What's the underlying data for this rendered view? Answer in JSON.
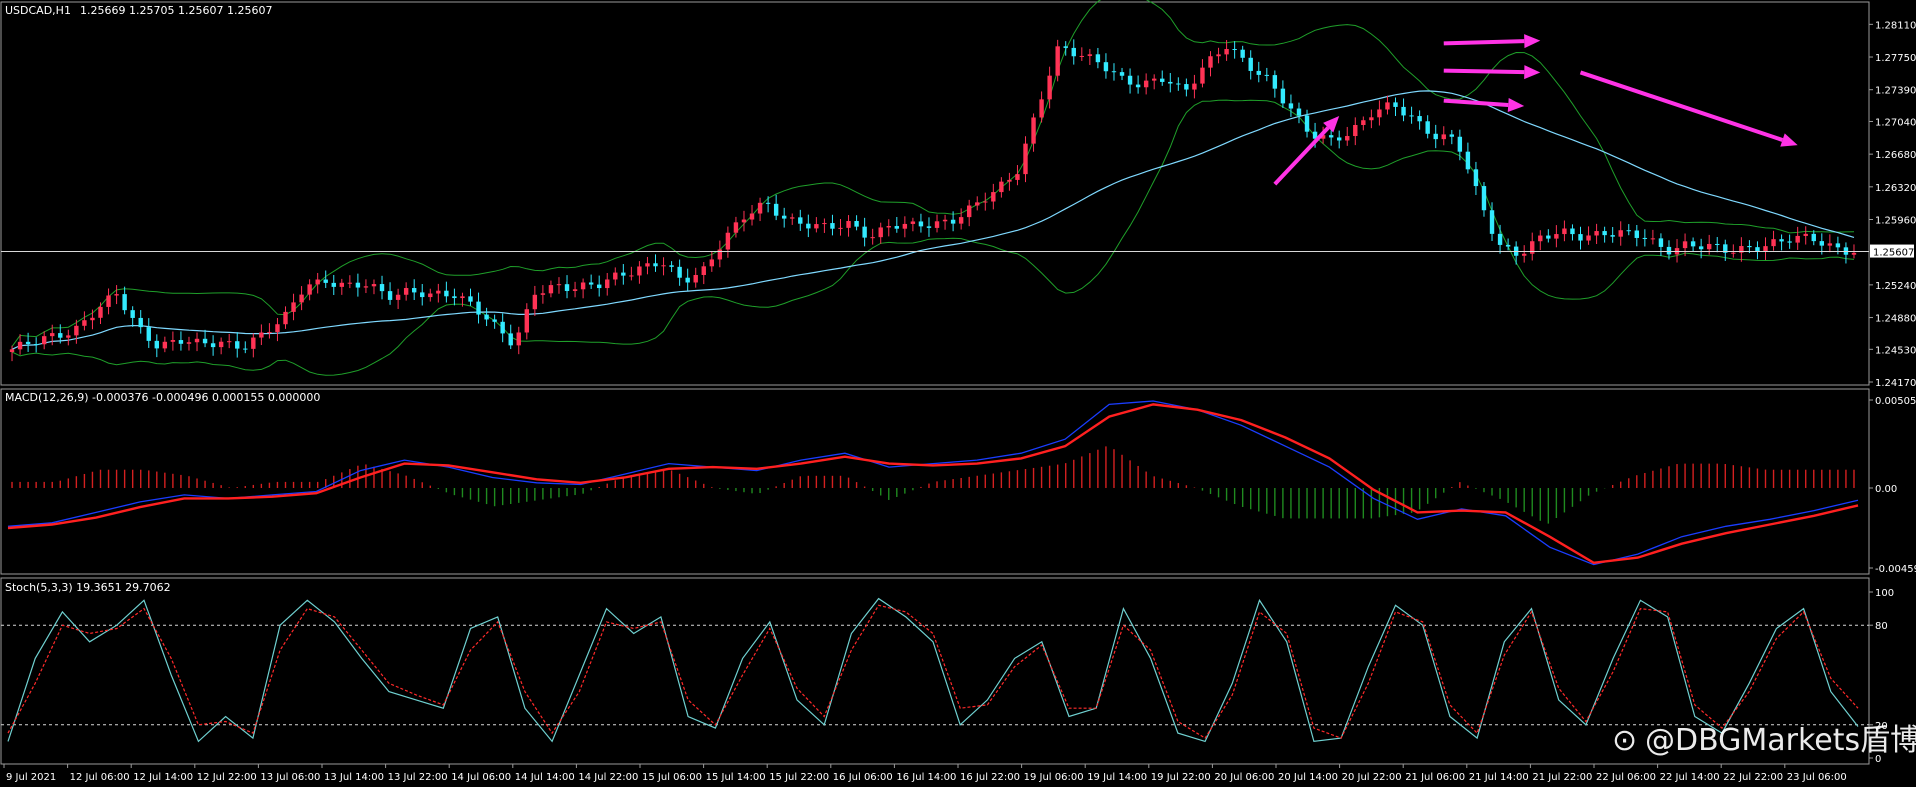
{
  "main": {
    "title": "USDCAD,H1",
    "ohlc": "1.25669 1.25705 1.25607 1.25607",
    "last_price": "1.25607"
  },
  "macd": {
    "title": "MACD(12,26,9) -0.000376 -0.000496 0.000155 0.000000"
  },
  "stoch": {
    "title": "Stoch(5,3,3) 19.3651 29.7062"
  },
  "watermark": {
    "text": "@DBGMarkets盾博"
  },
  "colors": {
    "bull": "#ff3355",
    "bear": "#33eaff",
    "bollinger": "#1f9f2a",
    "ma": "#7fd9ff",
    "macd_line": "#1a3dff",
    "signal_line": "#ff2020",
    "arrow": "#ff33e6",
    "stoch_main": "#6fd0d0",
    "stoch_signal": "#ff2a2a",
    "grid": "#d8d8d8"
  },
  "chart_data": [
    {
      "type": "candlestick",
      "title": "USDCAD,H1",
      "ylim": [
        1.2417,
        1.2829
      ],
      "y_ticks": [
        "1.28110",
        "1.27750",
        "1.27390",
        "1.27040",
        "1.26680",
        "1.26320",
        "1.25960",
        "1.25240",
        "1.24880",
        "1.24530",
        "1.24170"
      ],
      "current_price": 1.25607,
      "x_ticks": [
        "9 Jul 2021",
        "12 Jul 06:00",
        "12 Jul 14:00",
        "12 Jul 22:00",
        "13 Jul 06:00",
        "13 Jul 14:00",
        "13 Jul 22:00",
        "14 Jul 06:00",
        "14 Jul 14:00",
        "14 Jul 22:00",
        "15 Jul 06:00",
        "15 Jul 14:00",
        "15 Jul 22:00",
        "16 Jul 06:00",
        "16 Jul 14:00",
        "16 Jul 22:00",
        "19 Jul 06:00",
        "19 Jul 14:00",
        "19 Jul 22:00",
        "20 Jul 06:00",
        "20 Jul 14:00",
        "20 Jul 22:00",
        "21 Jul 06:00",
        "21 Jul 14:00",
        "21 Jul 22:00",
        "22 Jul 06:00",
        "22 Jul 14:00",
        "22 Jul 22:00",
        "23 Jul 06:00"
      ],
      "close_path": [
        1.2453,
        1.2459,
        1.2468,
        1.2476,
        1.2495,
        1.2512,
        1.2478,
        1.2458,
        1.2462,
        1.2457,
        1.2462,
        1.2457,
        1.2468,
        1.2486,
        1.2526,
        1.2529,
        1.252,
        1.2524,
        1.2514,
        1.2518,
        1.251,
        1.2514,
        1.2505,
        1.248,
        1.2455,
        1.2517,
        1.2525,
        1.252,
        1.2522,
        1.2536,
        1.2544,
        1.2549,
        1.2526,
        1.254,
        1.2576,
        1.2598,
        1.2612,
        1.2598,
        1.2592,
        1.2585,
        1.259,
        1.2579,
        1.2591,
        1.2587,
        1.259,
        1.2598,
        1.2612,
        1.2625,
        1.2648,
        1.2722,
        1.2785,
        1.2775,
        1.277,
        1.2753,
        1.2742,
        1.275,
        1.2738,
        1.2768,
        1.2786,
        1.2765,
        1.2752,
        1.2722,
        1.2688,
        1.2682,
        1.2695,
        1.2715,
        1.272,
        1.2705,
        1.269,
        1.2685,
        1.2622,
        1.2568,
        1.256,
        1.2575,
        1.258,
        1.2578,
        1.2583,
        1.258,
        1.2575,
        1.2563,
        1.257,
        1.2565,
        1.256,
        1.2566,
        1.257,
        1.2573,
        1.2575,
        1.2567,
        1.2561
      ],
      "series": [
        {
          "name": "Bollinger Bands",
          "type": "band"
        },
        {
          "name": "Moving Average",
          "type": "line"
        }
      ],
      "arrows": 5
    },
    {
      "type": "line",
      "title": "MACD(12,26,9) -0.000376 -0.000496 0.000155 0.000000",
      "ylim": [
        -0.004597,
        0.005055
      ],
      "y_ticks": [
        "0.005055",
        "0.00",
        "-0.004597"
      ],
      "values": {
        "macd": -0.000376,
        "signal": -0.000496,
        "osma": 0.000155
      },
      "macd_path": [
        -0.0022,
        -0.002,
        -0.0014,
        -0.0008,
        -0.0004,
        -0.0006,
        -0.0004,
        -0.0002,
        0.001,
        0.0016,
        0.0012,
        0.0006,
        0.0003,
        0.0002,
        0.0008,
        0.0014,
        0.0012,
        0.001,
        0.0016,
        0.002,
        0.0012,
        0.0014,
        0.0016,
        0.002,
        0.0028,
        0.0048,
        0.005,
        0.0045,
        0.0036,
        0.0024,
        0.0012,
        -0.0006,
        -0.0018,
        -0.0012,
        -0.0016,
        -0.0034,
        -0.0044,
        -0.0038,
        -0.0028,
        -0.0022,
        -0.0018,
        -0.0013,
        -0.0007
      ],
      "signal_path": [
        -0.0023,
        -0.0021,
        -0.0017,
        -0.0011,
        -0.0006,
        -0.0006,
        -0.0005,
        -0.0003,
        0.0006,
        0.0014,
        0.0013,
        0.0009,
        0.0005,
        0.0003,
        0.0006,
        0.0011,
        0.0012,
        0.0011,
        0.0014,
        0.0018,
        0.0014,
        0.0013,
        0.0014,
        0.0017,
        0.0024,
        0.0041,
        0.0048,
        0.0045,
        0.0039,
        0.0029,
        0.0017,
        -0.0001,
        -0.0014,
        -0.0013,
        -0.0014,
        -0.0028,
        -0.0043,
        -0.004,
        -0.0032,
        -0.0026,
        -0.0021,
        -0.0016,
        -0.001
      ]
    },
    {
      "type": "line",
      "title": "Stoch(5,3,3) 19.3651 29.7062",
      "ylim": [
        0,
        100
      ],
      "y_ticks": [
        "100",
        "80",
        "20",
        "0"
      ],
      "levels": [
        80,
        20
      ],
      "values": {
        "main": 19.3651,
        "signal": 29.7062
      },
      "main_path": [
        10,
        60,
        88,
        70,
        80,
        95,
        50,
        10,
        25,
        12,
        80,
        95,
        82,
        60,
        40,
        35,
        30,
        78,
        85,
        30,
        10,
        50,
        90,
        75,
        85,
        25,
        18,
        60,
        82,
        35,
        20,
        75,
        96,
        85,
        70,
        20,
        35,
        60,
        70,
        25,
        30,
        90,
        60,
        15,
        10,
        45,
        95,
        70,
        10,
        12,
        55,
        92,
        80,
        25,
        12,
        70,
        90,
        35,
        20,
        60,
        95,
        85,
        25,
        15,
        45,
        78,
        90,
        40,
        19
      ],
      "signal_path": [
        15,
        45,
        80,
        75,
        78,
        90,
        60,
        20,
        22,
        15,
        65,
        90,
        85,
        65,
        45,
        38,
        32,
        65,
        82,
        40,
        15,
        40,
        82,
        78,
        82,
        35,
        20,
        50,
        78,
        42,
        25,
        65,
        92,
        88,
        75,
        30,
        32,
        55,
        68,
        30,
        30,
        80,
        65,
        22,
        12,
        38,
        88,
        75,
        18,
        12,
        45,
        88,
        82,
        32,
        15,
        62,
        88,
        42,
        22,
        52,
        90,
        88,
        32,
        18,
        40,
        72,
        88,
        48,
        30
      ]
    }
  ]
}
